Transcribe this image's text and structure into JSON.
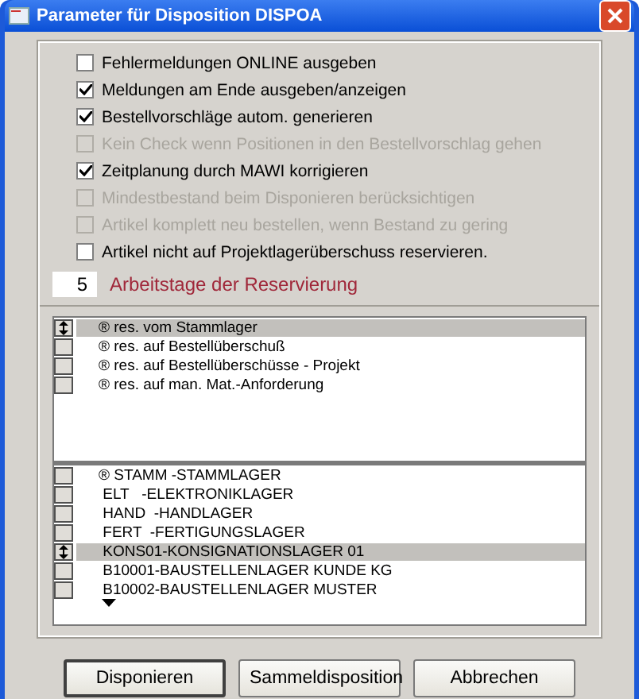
{
  "window": {
    "title": "Parameter für Disposition DISPOA"
  },
  "options": [
    {
      "label": "Fehlermeldungen ONLINE ausgeben",
      "checked": false,
      "disabled": false
    },
    {
      "label": "Meldungen am Ende ausgeben/anzeigen",
      "checked": true,
      "disabled": false
    },
    {
      "label": "Bestellvorschläge autom. generieren",
      "checked": true,
      "disabled": false
    },
    {
      "label": "Kein Check wenn Positionen in den Bestellvorschlag gehen",
      "checked": false,
      "disabled": true
    },
    {
      "label": "Zeitplanung durch MAWI korrigieren",
      "checked": true,
      "disabled": false
    },
    {
      "label": "Mindestbestand beim Disponieren berücksichtigen",
      "checked": false,
      "disabled": true
    },
    {
      "label": "Artikel komplett neu bestellen, wenn Bestand zu gering",
      "checked": false,
      "disabled": true
    },
    {
      "label": "Artikel nicht auf Projektlagerüberschuss reservieren.",
      "checked": false,
      "disabled": false
    }
  ],
  "days": {
    "value": "5",
    "label": "Arbeitstage der Reservierung"
  },
  "reservation_list": [
    {
      "label": "® res. vom Stammlager",
      "selected": true
    },
    {
      "label": "® res. auf Bestellüberschuß",
      "selected": false
    },
    {
      "label": "® res. auf Bestellüberschüsse - Projekt",
      "selected": false
    },
    {
      "label": "® res. auf man. Mat.-Anforderung",
      "selected": false
    }
  ],
  "storage_list": [
    {
      "label": "® STAMM -STAMMLAGER",
      "selected": false
    },
    {
      "label": " ELT   -ELEKTRONIKLAGER",
      "selected": false
    },
    {
      "label": " HAND  -HANDLAGER",
      "selected": false
    },
    {
      "label": " FERT  -FERTIGUNGSLAGER",
      "selected": false
    },
    {
      "label": " KONS01-KONSIGNATIONSLAGER 01",
      "selected": true
    },
    {
      "label": " B10001-BAUSTELLENLAGER KUNDE KG",
      "selected": false
    },
    {
      "label": " B10002-BAUSTELLENLAGER MUSTER",
      "selected": false
    }
  ],
  "buttons": [
    {
      "label": "Disponieren",
      "default": true
    },
    {
      "label": "Sammeldisposition",
      "default": false
    },
    {
      "label": "Abbrechen",
      "default": false
    }
  ]
}
